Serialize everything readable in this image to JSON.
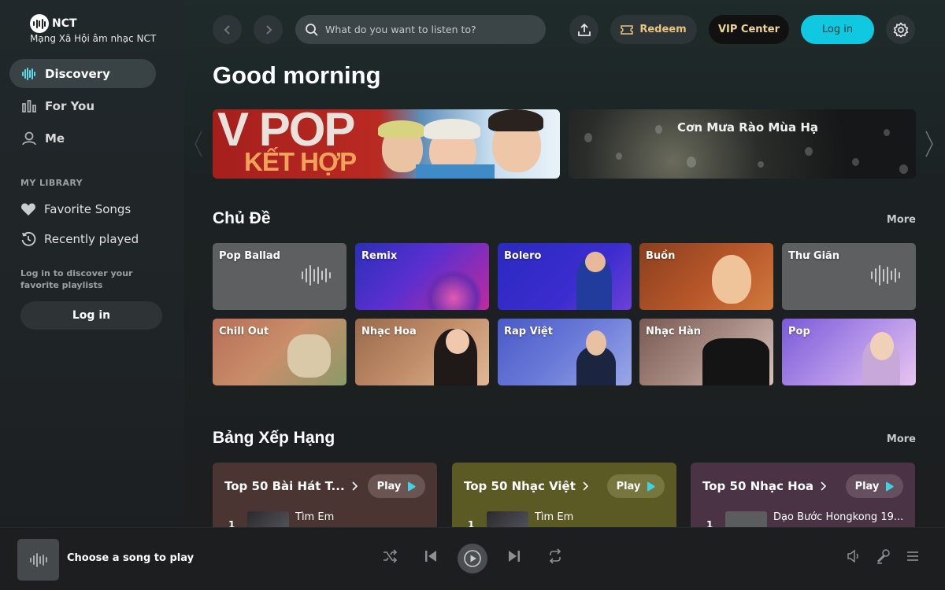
{
  "brand": {
    "name": "NCT",
    "subtitle": "Mạng Xã Hội âm nhạc NCT"
  },
  "sidebar": {
    "nav": [
      {
        "label": "Discovery",
        "icon": "waveform-icon",
        "active": true
      },
      {
        "label": "For You",
        "icon": "equalizer-icon",
        "active": false
      },
      {
        "label": "Me",
        "icon": "user-icon",
        "active": false
      }
    ],
    "library_title": "MY LIBRARY",
    "library": [
      {
        "label": "Favorite Songs",
        "icon": "heart-icon"
      },
      {
        "label": "Recently played",
        "icon": "history-icon"
      }
    ],
    "login_hint": "Log in to discover your favorite playlists",
    "login_label": "Log in"
  },
  "header": {
    "search_placeholder": "What do you want to listen to?",
    "redeem_label": "Redeem",
    "vip_label": "VIP Center",
    "login_label": "Log in"
  },
  "greeting": "Good morning",
  "banners": [
    {
      "line1": "V POP",
      "line2": "KẾT HỢP"
    },
    {
      "title": "Cơn Mưa Rào Mùa Hạ"
    }
  ],
  "topics": {
    "title": "Chủ Đề",
    "more": "More",
    "items": [
      {
        "label": "Pop Ballad"
      },
      {
        "label": "Remix"
      },
      {
        "label": "Bolero"
      },
      {
        "label": "Buồn"
      },
      {
        "label": "Thư Giãn"
      },
      {
        "label": "Chill Out"
      },
      {
        "label": "Nhạc Hoa"
      },
      {
        "label": "Rap Việt"
      },
      {
        "label": "Nhạc Hàn"
      },
      {
        "label": "Pop"
      }
    ]
  },
  "charts": {
    "title": "Bảng Xếp Hạng",
    "more": "More",
    "items": [
      {
        "title": "Top 50 Bài Hát T...",
        "play": "Play",
        "rank": "1",
        "song": "Tìm Em",
        "color": "#4a3532"
      },
      {
        "title": "Top 50 Nhạc Việt",
        "play": "Play",
        "rank": "1",
        "song": "Tìm Em",
        "color": "#5b5a24"
      },
      {
        "title": "Top 50 Nhạc Hoa",
        "play": "Play",
        "rank": "1",
        "song": "Dạo Bước Hongkong 19...",
        "color": "#4a3345"
      }
    ]
  },
  "player": {
    "now_playing": "Choose a song to play"
  },
  "colors": {
    "accent": "#10c9e0",
    "vip": "#f0d59a",
    "redeem": "#e9c47a"
  }
}
